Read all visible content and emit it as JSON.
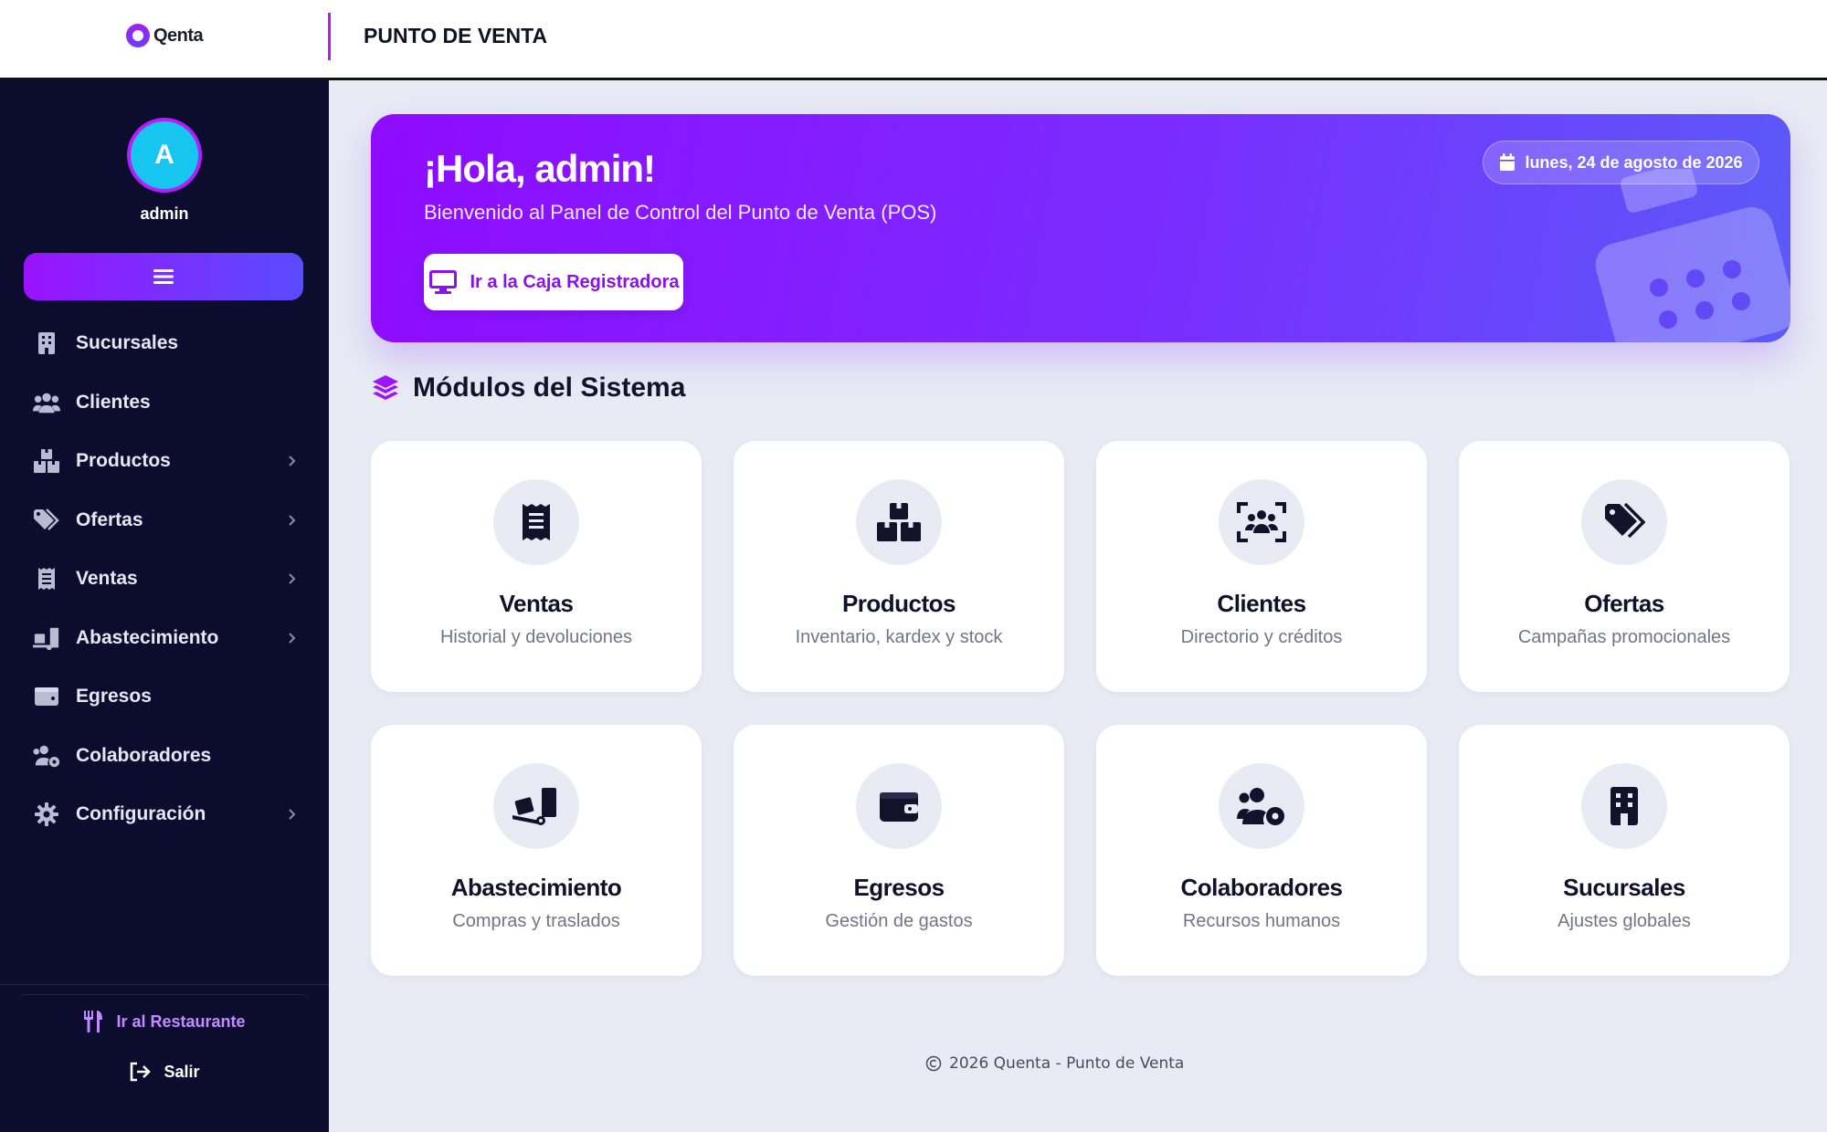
{
  "header": {
    "logo_text": "Qenta",
    "title": "PUNTO DE VENTA"
  },
  "user": {
    "avatar_letter": "A",
    "name": "admin"
  },
  "sidebar": {
    "items": [
      {
        "label": "Sucursales",
        "icon": "building-icon",
        "has_submenu": false
      },
      {
        "label": "Clientes",
        "icon": "users-icon",
        "has_submenu": false
      },
      {
        "label": "Productos",
        "icon": "boxes-icon",
        "has_submenu": true
      },
      {
        "label": "Ofertas",
        "icon": "tags-icon",
        "has_submenu": true
      },
      {
        "label": "Ventas",
        "icon": "receipt-icon",
        "has_submenu": true
      },
      {
        "label": "Abastecimiento",
        "icon": "dolly-icon",
        "has_submenu": true
      },
      {
        "label": "Egresos",
        "icon": "wallet-icon",
        "has_submenu": false
      },
      {
        "label": "Colaboradores",
        "icon": "users-gear-icon",
        "has_submenu": false
      },
      {
        "label": "Configuración",
        "icon": "gear-icon",
        "has_submenu": true
      }
    ],
    "restaurant_link": "Ir al Restaurante",
    "logout": "Salir"
  },
  "hero": {
    "title": "¡Hola, admin!",
    "subtitle": "Bienvenido al Panel de Control del Punto de Venta (POS)",
    "button_label": "Ir a la Caja Registradora",
    "date": "lunes, 24 de agosto de 2026"
  },
  "modules": {
    "title": "Módulos del Sistema",
    "cards": [
      {
        "title": "Ventas",
        "subtitle": "Historial y devoluciones",
        "icon": "receipt-icon"
      },
      {
        "title": "Productos",
        "subtitle": "Inventario, kardex y stock",
        "icon": "boxes-icon"
      },
      {
        "title": "Clientes",
        "subtitle": "Directorio y créditos",
        "icon": "users-viewfinder-icon"
      },
      {
        "title": "Ofertas",
        "subtitle": "Campañas promocionales",
        "icon": "tags-icon"
      },
      {
        "title": "Abastecimiento",
        "subtitle": "Compras y traslados",
        "icon": "dolly-icon"
      },
      {
        "title": "Egresos",
        "subtitle": "Gestión de gastos",
        "icon": "wallet-icon"
      },
      {
        "title": "Colaboradores",
        "subtitle": "Recursos humanos",
        "icon": "users-gear-icon"
      },
      {
        "title": "Sucursales",
        "subtitle": "Ajustes globales",
        "icon": "building-icon"
      }
    ]
  },
  "footer": {
    "text": "2026 Quenta - Punto de Venta"
  },
  "colors": {
    "accent": "#8f0bff",
    "sidebar_bg": "#0c0c2e",
    "page_bg": "#e8ebf4",
    "avatar_bg": "#16c6ee"
  }
}
